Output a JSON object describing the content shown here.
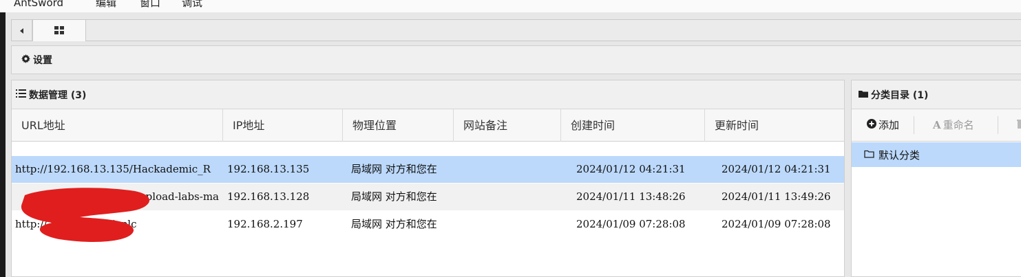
{
  "menubar": {
    "items": [
      "AntSword",
      "编辑",
      "窗口",
      "调试"
    ]
  },
  "tabs": {
    "scroll_left_icon": "caret-left-icon",
    "grid_icon": "grid-icon"
  },
  "toolbar": {
    "settings_label": "设置",
    "settings_icon": "gear-icon"
  },
  "data_panel": {
    "title": "数据管理 (3)",
    "icon": "list-icon",
    "columns": [
      "URL地址",
      "IP地址",
      "物理位置",
      "网站备注",
      "创建时间",
      "更新时间"
    ],
    "rows": [
      {
        "url": "http://192.168.13.135/Hackademic_R",
        "ip": "192.168.13.135",
        "location": "局域网 对方和您在",
        "note": "",
        "created": "2024/01/12 04:21:31",
        "updated": "2024/01/12 04:21:31"
      },
      {
        "url": "h upload-labs-ma",
        "ip": "192.168.13.128",
        "location": "局域网 对方和您在",
        "note": "",
        "created": "2024/01/11 13:48:26",
        "updated": "2024/01/11 13:49:26"
      },
      {
        "url": "http:// upload-labs/uplc",
        "ip": "192.168.2.197",
        "location": "局域网 对方和您在",
        "note": "",
        "created": "2024/01/09 07:28:08",
        "updated": "2024/01/09 07:28:08"
      }
    ]
  },
  "category_panel": {
    "title": "分类目录 (1)",
    "icon": "folder-icon",
    "add_label": "添加",
    "rename_label": "重命名",
    "items": [
      "默认分类"
    ]
  },
  "colors": {
    "selection": "#bcd9fb",
    "redaction": "#e01e1e"
  }
}
